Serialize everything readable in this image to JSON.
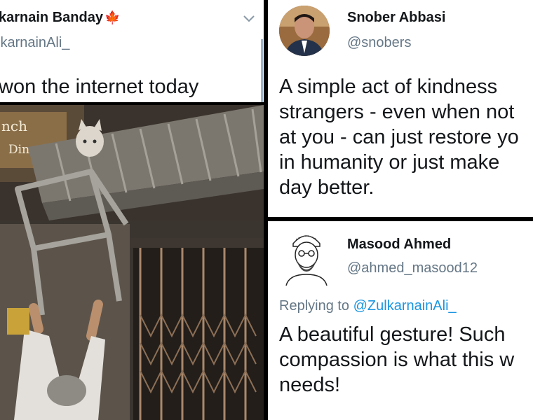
{
  "tweet_left": {
    "display_name": "karnain Banday",
    "flag": "🍁",
    "handle": "lkarnainAli_",
    "text": "won the internet today"
  },
  "photo": {
    "sign_lines": [
      "nch",
      "Din"
    ]
  },
  "tweet_top_right": {
    "display_name": "Snober Abbasi",
    "handle": "@snobers",
    "text_lines": [
      "A simple act of kindness",
      "strangers - even when not",
      "at you - can just restore yo",
      "in humanity or just make",
      "day better."
    ]
  },
  "tweet_bottom_right": {
    "display_name": "Masood Ahmed",
    "handle": "@ahmed_masood12",
    "reply_prefix": "Replying to",
    "reply_handle": "@ZulkarnainAli_",
    "text_lines": [
      "A beautiful gesture! Such",
      "compassion is what this w",
      "needs!"
    ]
  },
  "colors": {
    "link": "#1b95e0",
    "secondary_text": "#657786",
    "flag": "#e0282e"
  }
}
